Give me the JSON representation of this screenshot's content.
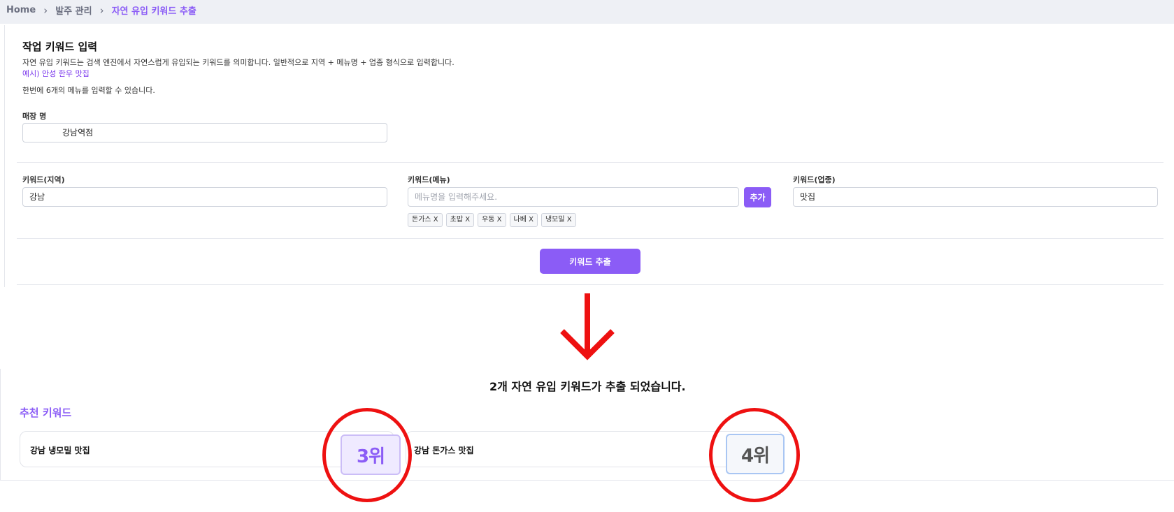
{
  "breadcrumb": {
    "home": "Home",
    "level1": "발주 관리",
    "current": "자연 유입 키워드 추출"
  },
  "form": {
    "title": "작업 키워드 입력",
    "description": "자연 유입 키워드는 검색 엔진에서 자연스럽게 유입되는 키워드를 의미합니다. 일반적으로 지역 + 메뉴명 + 업종 형식으로 입력합니다.",
    "example": "예시) 안성 한우 맛집",
    "limit_note": "한번에 6개의 메뉴를 입력할 수 있습니다.",
    "store_label": "매장 명",
    "store_value": "강남역점",
    "region_label": "키워드(지역)",
    "region_value": "강남",
    "menu_label": "키워드(메뉴)",
    "menu_placeholder": "메뉴명을 입력해주세요.",
    "add_button": "추가",
    "menu_tags": [
      "돈가스 X",
      "초밥 X",
      "우동 X",
      "나베 X",
      "냉모밀 X"
    ],
    "category_label": "키워드(업종)",
    "category_value": "맛집",
    "extract_button": "키워드 추출"
  },
  "result": {
    "message": "2개 자연 유입 키워드가 추출 되었습니다.",
    "reco_title": "추천 키워드",
    "keywords": [
      {
        "text": "강남 냉모밀 맛집",
        "rank": "3위"
      },
      {
        "text": "강남 돈가스 맛집",
        "rank": "4위"
      }
    ]
  },
  "colors": {
    "accent": "#8b5cf6",
    "annotation": "#ee1111"
  },
  "icons": {
    "breadcrumb_separator": "chevron-right-icon",
    "arrow": "arrow-down-icon"
  }
}
